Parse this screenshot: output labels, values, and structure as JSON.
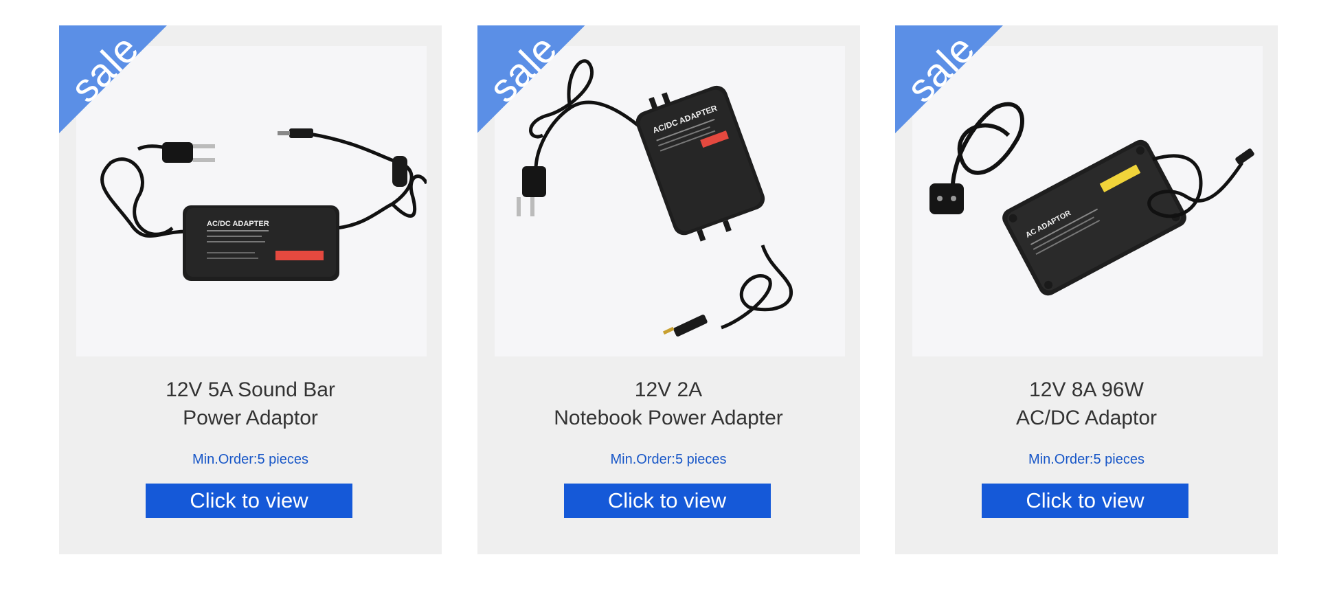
{
  "products": [
    {
      "badge": "sale",
      "title_line1": "12V 5A Sound Bar",
      "title_line2": "Power Adaptor",
      "min_order": "Min.Order:5 pieces",
      "button_label": "Click to view",
      "label_text": "AC/DC ADAPTER"
    },
    {
      "badge": "sale",
      "title_line1": "12V 2A",
      "title_line2": "Notebook Power Adapter",
      "min_order": "Min.Order:5 pieces",
      "button_label": "Click to view",
      "label_text": "AC/DC ADAPTER"
    },
    {
      "badge": "sale",
      "title_line1": "12V 8A 96W",
      "title_line2": "AC/DC Adaptor",
      "min_order": "Min.Order:5 pieces",
      "button_label": "Click to view",
      "label_text": "AC ADAPTOR"
    }
  ],
  "colors": {
    "card_bg": "#efefef",
    "sale_ribbon": "#5b8fe6",
    "button_bg": "#1559d8",
    "min_order_text": "#1756c7",
    "title_text": "#333333"
  },
  "icons": [
    "sale-ribbon",
    "power-adapter-image"
  ]
}
